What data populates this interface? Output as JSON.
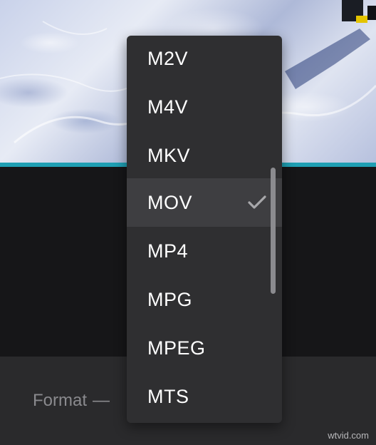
{
  "format_label": "Format",
  "format_dash": "—",
  "dropdown": {
    "items": [
      {
        "label": "M2V",
        "selected": false
      },
      {
        "label": "M4V",
        "selected": false
      },
      {
        "label": "MKV",
        "selected": false
      },
      {
        "label": "MOV",
        "selected": true
      },
      {
        "label": "MP4",
        "selected": false
      },
      {
        "label": "MPG",
        "selected": false
      },
      {
        "label": "MPEG",
        "selected": false
      },
      {
        "label": "MTS",
        "selected": false
      }
    ]
  },
  "watermark": "wtvid.com",
  "colors": {
    "accent": "#1f9fb3",
    "dropdown_bg": "#2f2f31",
    "selected_bg": "#3e3e41",
    "checkmark": "#a8a8ab"
  }
}
